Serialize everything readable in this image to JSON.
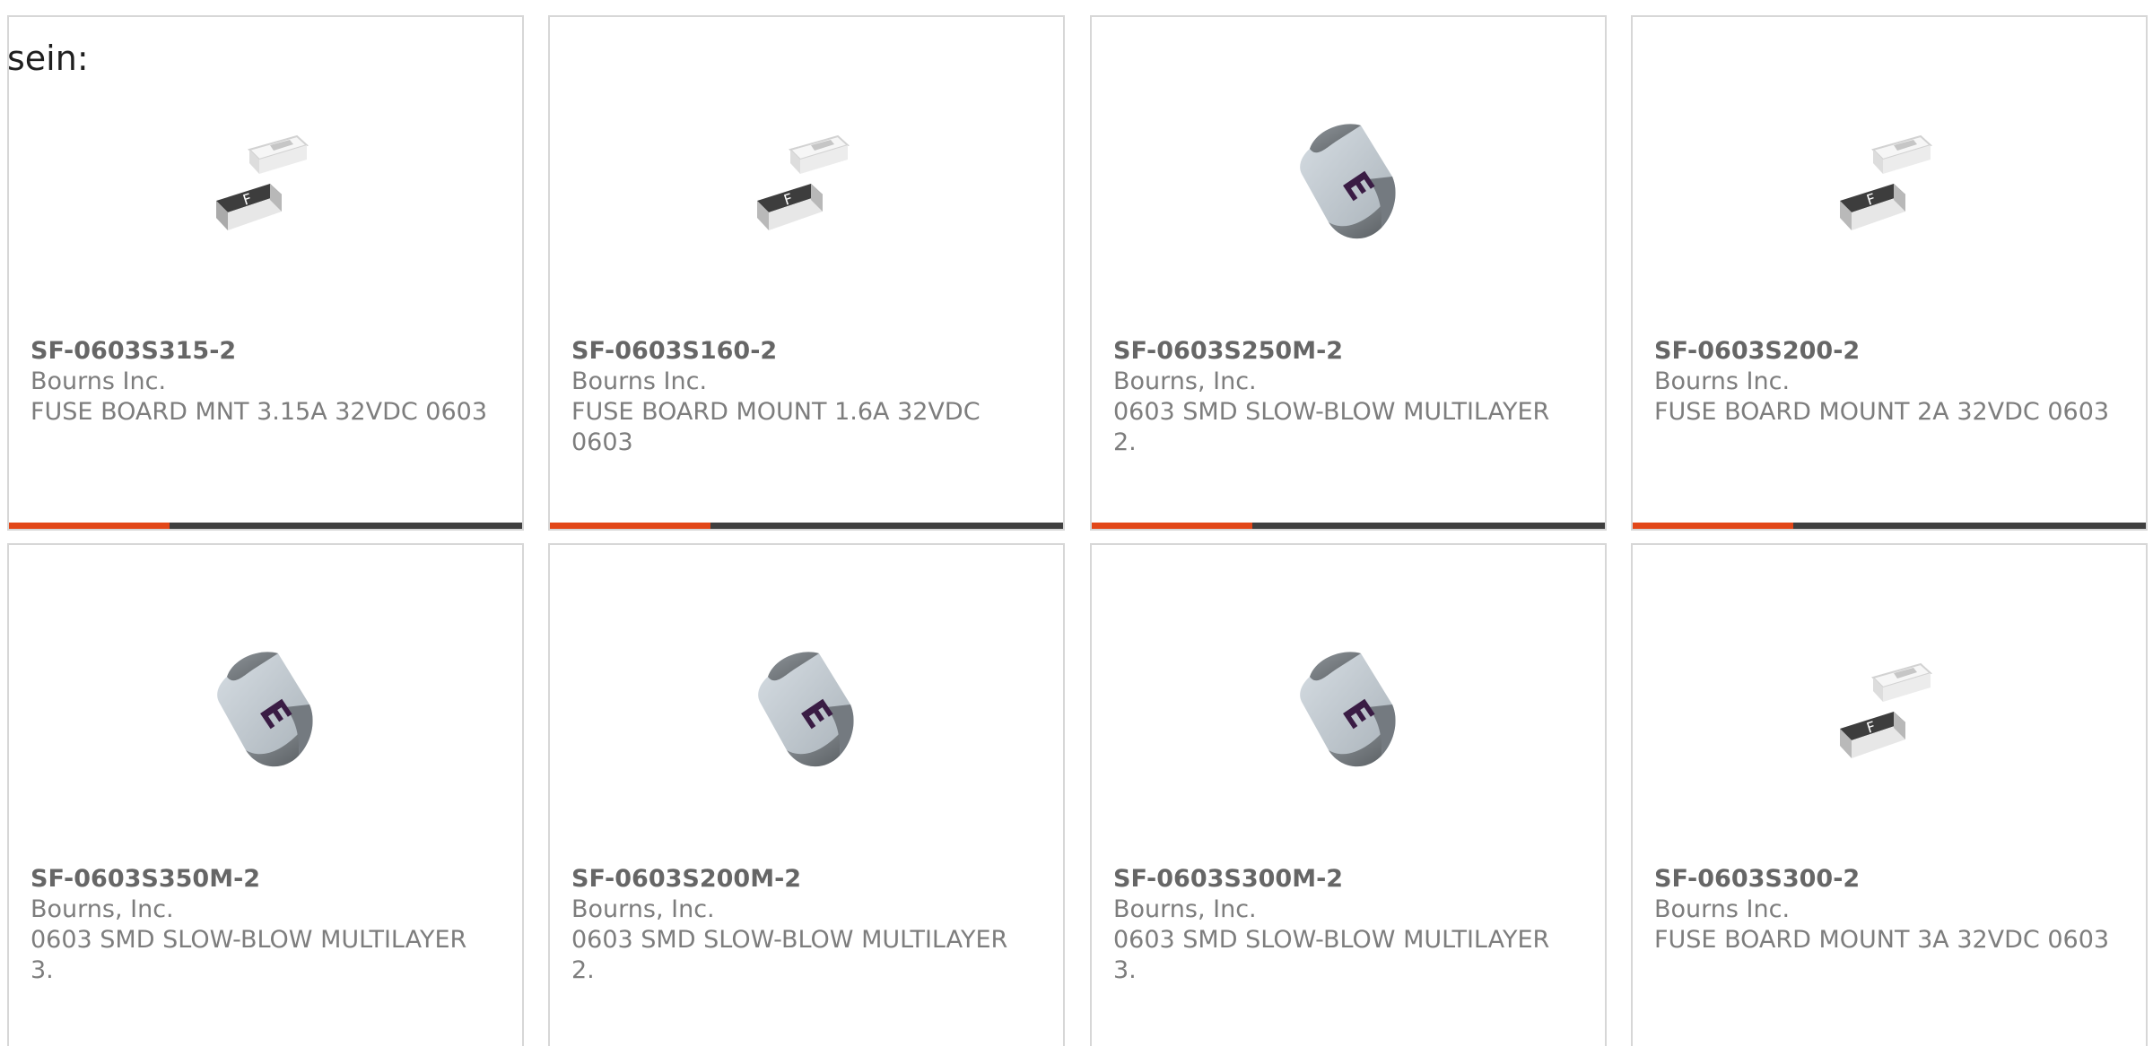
{
  "intro_text": "sein:",
  "products": [
    {
      "part_number": "SF-0603S315-2",
      "manufacturer": "Bourns Inc.",
      "description": "FUSE BOARD MNT 3.15A 32VDC 0603",
      "image_type": "fuse-pair-image"
    },
    {
      "part_number": "SF-0603S160-2",
      "manufacturer": "Bourns Inc.",
      "description": "FUSE BOARD MOUNT 1.6A 32VDC 0603",
      "image_type": "fuse-pair-image"
    },
    {
      "part_number": "SF-0603S250M-2",
      "manufacturer": "Bourns, Inc.",
      "description": "0603 SMD SLOW-BLOW MULTILAYER 2.",
      "image_type": "multilayer-fuse-image"
    },
    {
      "part_number": "SF-0603S200-2",
      "manufacturer": "Bourns Inc.",
      "description": "FUSE BOARD MOUNT 2A 32VDC 0603",
      "image_type": "fuse-pair-image"
    },
    {
      "part_number": "SF-0603S350M-2",
      "manufacturer": "Bourns, Inc.",
      "description": "0603 SMD SLOW-BLOW MULTILAYER 3.",
      "image_type": "multilayer-fuse-image"
    },
    {
      "part_number": "SF-0603S200M-2",
      "manufacturer": "Bourns, Inc.",
      "description": "0603 SMD SLOW-BLOW MULTILAYER 2.",
      "image_type": "multilayer-fuse-image"
    },
    {
      "part_number": "SF-0603S300M-2",
      "manufacturer": "Bourns, Inc.",
      "description": "0603 SMD SLOW-BLOW MULTILAYER 3.",
      "image_type": "multilayer-fuse-image"
    },
    {
      "part_number": "SF-0603S300-2",
      "manufacturer": "Bourns Inc.",
      "description": "FUSE BOARD MOUNT 3A 32VDC 0603",
      "image_type": "fuse-pair-image"
    }
  ],
  "colors": {
    "accent": "#e24719",
    "bar": "#3f3f3f",
    "border": "#d7d7d7",
    "text": "#707070"
  }
}
